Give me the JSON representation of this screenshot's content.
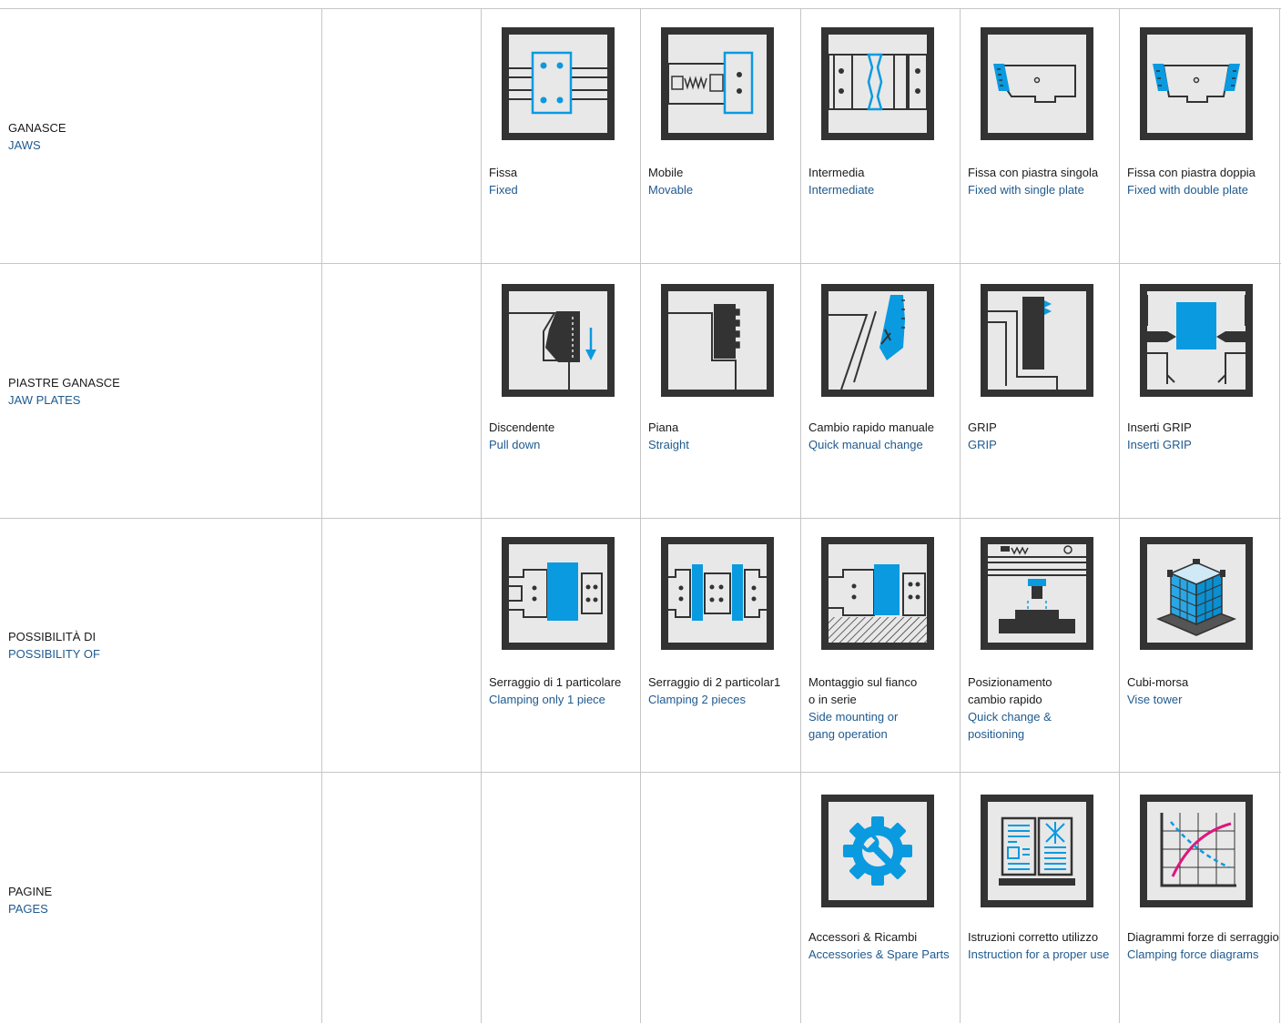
{
  "colors": {
    "frame": "#333333",
    "background": "#e8e8e8",
    "accent_blue": "#0a9ae0",
    "accent_magenta": "#e0157e",
    "english_text": "#1f5a8f",
    "grid_line": "#c6c6c6"
  },
  "rows": [
    {
      "label_it": "GANASCE",
      "label_en": "JAWS",
      "items": [
        {
          "icon": "fixed-jaw-icon",
          "it": "Fissa",
          "en": "Fixed"
        },
        {
          "icon": "movable-jaw-icon",
          "it": "Mobile",
          "en": "Movable"
        },
        {
          "icon": "intermediate-jaw-icon",
          "it": "Intermedia",
          "en": "Intermediate"
        },
        {
          "icon": "fixed-single-plate-icon",
          "it": "Fissa con piastra singola",
          "en": "Fixed with single plate"
        },
        {
          "icon": "fixed-double-plate-icon",
          "it": "Fissa con piastra doppia",
          "en": "Fixed with double plate"
        }
      ]
    },
    {
      "label_it": "PIASTRE GANASCE",
      "label_en": "JAW PLATES",
      "items": [
        {
          "icon": "pull-down-plate-icon",
          "it": "Discendente",
          "en": "Pull down"
        },
        {
          "icon": "straight-plate-icon",
          "it": "Piana",
          "en": "Straight"
        },
        {
          "icon": "quick-manual-change-icon",
          "it": "Cambio rapido manuale",
          "en": "Quick manual change"
        },
        {
          "icon": "grip-plate-icon",
          "it": "GRIP",
          "en": "GRIP"
        },
        {
          "icon": "grip-inserts-icon",
          "it": "Inserti GRIP",
          "en": "Inserti GRIP"
        }
      ]
    },
    {
      "label_it": "POSSIBILITÀ DI",
      "label_en": "POSSIBILITY OF",
      "items": [
        {
          "icon": "clamping-one-piece-icon",
          "it": "Serraggio di 1 particolare",
          "en": "Clamping only 1 piece"
        },
        {
          "icon": "clamping-two-pieces-icon",
          "it": "Serraggio di 2 particolar1",
          "en": "Clamping 2 pieces"
        },
        {
          "icon": "side-mounting-icon",
          "it": "Montaggio sul fianco",
          "it2": "o in serie",
          "en": "Side mounting or",
          "en2": "gang operation"
        },
        {
          "icon": "quick-change-positioning-icon",
          "it": "Posizionamento",
          "it2": "cambio rapido",
          "en": "Quick change &",
          "en2": "positioning"
        },
        {
          "icon": "vise-tower-icon",
          "it": "Cubi-morsa",
          "en": "Vise tower"
        }
      ]
    },
    {
      "label_it": "PAGINE",
      "label_en": "PAGES",
      "items": [
        {
          "icon": "accessories-gear-wrench-icon",
          "it": "Accessori & Ricambi",
          "en": "Accessories & Spare Parts"
        },
        {
          "icon": "instruction-book-icon",
          "it": "Istruzioni corretto utilizzo",
          "en": "Instruction for a proper use"
        },
        {
          "icon": "clamping-force-chart-icon",
          "it": "Diagrammi forze di serraggio",
          "en": "Clamping force diagrams"
        }
      ]
    }
  ]
}
